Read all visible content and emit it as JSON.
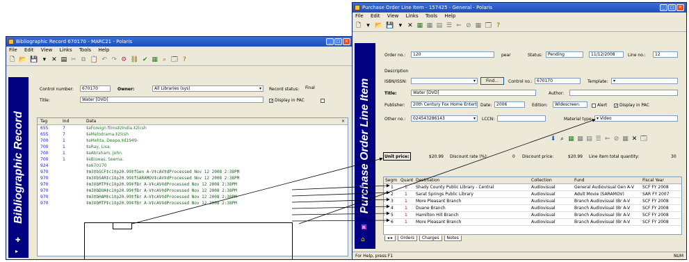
{
  "bib": {
    "title": "Bibliographic Record 670170 - MARC21 - Polaris",
    "menu": [
      "File",
      "Edit",
      "View",
      "Links",
      "Tools",
      "Help"
    ],
    "sidebar_label": "Bibliographic Record",
    "control_number_label": "Control number:",
    "control_number": "670170",
    "owner_label": "Owner:",
    "owner_value": "All Libraries (sys)",
    "record_status_label": "Record status:",
    "record_status": "Final",
    "title_label": "Title:",
    "title_value": "Water [DVD]",
    "display_pac": "Display in PAC",
    "header": {
      "tag": "Tag",
      "ind": "Ind",
      "data": "Data"
    },
    "rows": [
      {
        "tag": "655",
        "ind": "7",
        "data": "‡aForeign films‡zIndia.‡2lcsh",
        "hl": false
      },
      {
        "tag": "655",
        "ind": "7",
        "data": "‡aMelodrama.‡2lcsh",
        "hl": false
      },
      {
        "tag": "700",
        "ind": "1",
        "data": "‡aMehta, Deepa,‡d1949-",
        "hl": false
      },
      {
        "tag": "700",
        "ind": "1",
        "data": "‡aRay, Lisa.",
        "hl": false
      },
      {
        "tag": "700",
        "ind": "1",
        "data": "‡aAbraham, John.",
        "hl": false
      },
      {
        "tag": "700",
        "ind": "1",
        "data": "‡aBiswas, Seema.",
        "hl": false
      },
      {
        "tag": "924",
        "ind": "",
        "data": "‡a670170",
        "hl": false
      },
      {
        "tag": "970",
        "ind": "",
        "data": "‡m3‡bSCF‡c1‡p20.99‡fGen A-V‡cAV‡dProcessed  Nov 12 2008  2:38PM",
        "hl": true
      },
      {
        "tag": "970",
        "ind": "",
        "data": "‡m3‡bSAR‡c1‡p20.99‡fSARAMOV‡cAV‡dProcessed  Nov 12 2008  2:38PM",
        "hl": true
      },
      {
        "tag": "970",
        "ind": "",
        "data": "‡m3‡bMTP‡c1‡p20.99‡fBr A-V‡cAV‡dProcessed  Nov 12 2008  2:38PM",
        "hl": true
      },
      {
        "tag": "970",
        "ind": "",
        "data": "‡m3‡bDUA‡c1‡p20.99‡fBr A-V‡cAV‡dProcessed  Nov 12 2008  2:38PM",
        "hl": true
      },
      {
        "tag": "970",
        "ind": "",
        "data": "‡m3‡bHAM‡c1‡p20.99‡fBr A-V‡cAV‡dProcessed  Nov 12 2008  2:38PM",
        "hl": true
      },
      {
        "tag": "970",
        "ind": "",
        "data": "‡m3‡bMTP‡c1‡p20.99‡fBr A-V‡cAV‡dProcessed  Nov 12 2008  2:38PM",
        "hl": true
      }
    ]
  },
  "po": {
    "title": "Purchase Order Line Item - 157425 - General - Polaris",
    "menu": [
      "File",
      "Edit",
      "View",
      "Links",
      "Tools",
      "Help"
    ],
    "sidebar_label": "Purchase Order Line Item",
    "order_no_label": "Order no.:",
    "order_no": "120",
    "order_no_suffix": "pear",
    "status_label": "Status:",
    "status": "Pending",
    "date": "11/12/2008",
    "line_no_label": "Line no.:",
    "line_no": "12",
    "description_label": "Description",
    "isbn_label": "ISBN/ISSN:",
    "find_button": "Find...",
    "control_no_label": "Control no.:",
    "control_no": "670170",
    "template_label": "Template:",
    "title_label": "Title:",
    "title_value": "Water [DVD]",
    "author_label": "Author:",
    "publisher_label": "Publisher:",
    "publisher_value": "20th Century Fox Home Enterta",
    "date_label": "Date:",
    "date_value": "2006",
    "edition_label": "Edition:",
    "edition_value": "Widescreen.",
    "alert_label": "Alert",
    "display_pac_label": "Display in PAC",
    "other_no_label": "Other no.:",
    "other_no_value": "024543286143",
    "lccn_label": "LCCN:",
    "material_type_label": "Material type:",
    "material_type_value": "Video",
    "unit_price_label": "Unit price:",
    "unit_price": "$20.99",
    "discount_rate_label": "Discount rate (%):",
    "discount_rate": "0",
    "discount_price_label": "Discount price:",
    "discount_price": "$20.99",
    "total_qty_label": "Line item total quantity:",
    "total_qty": "30",
    "grid_header": {
      "seg": "Segm",
      "qty": "Quant",
      "desc": "Destination",
      "coll": "Collection",
      "fund": "Fund",
      "fy": "Fiscal Year"
    },
    "segments": [
      {
        "seg": "1",
        "qty": "1",
        "desc": "Shady County Public Library - Central",
        "coll": "Audiovisual",
        "fund": "General Audiovisual Gen A-V",
        "fy": "SCF FY 2008"
      },
      {
        "seg": "2",
        "qty": "1",
        "desc": "Sarat Springs Public Library",
        "coll": "Audiovisual",
        "fund": "Adult Movie (SARAMOV)",
        "fy": "SAR FY 2007"
      },
      {
        "seg": "3",
        "qty": "1",
        "desc": "More Pleasant Branch",
        "coll": "Audiovisual",
        "fund": "Branch Audiovisual (Br A-V",
        "fy": "SCF FY 2008"
      },
      {
        "seg": "4",
        "qty": "1",
        "desc": "Duane Branch",
        "coll": "Audiovisual",
        "fund": "Branch Audiovisual (Br A-V",
        "fy": "SCF FY 2008"
      },
      {
        "seg": "5",
        "qty": "1",
        "desc": "Hamilton Hill Branch",
        "coll": "Audiovisual",
        "fund": "Branch Audiovisual (Br A-V",
        "fy": "SCF FY 2008"
      },
      {
        "seg": "6",
        "qty": "1",
        "desc": "More Pleasant Branch",
        "coll": "Audiovisual",
        "fund": "Branch Audiovisual (Br A-V",
        "fy": "SCF FY 2008"
      }
    ],
    "tabs": [
      "Orders",
      "Charges",
      "Notes"
    ],
    "status_bar": "For Help, press F1",
    "status_bar_right": "NUM"
  },
  "colors": {
    "sidebar": "#000080",
    "titlebar": "#1d4eb8",
    "window": "#ece9d8"
  }
}
